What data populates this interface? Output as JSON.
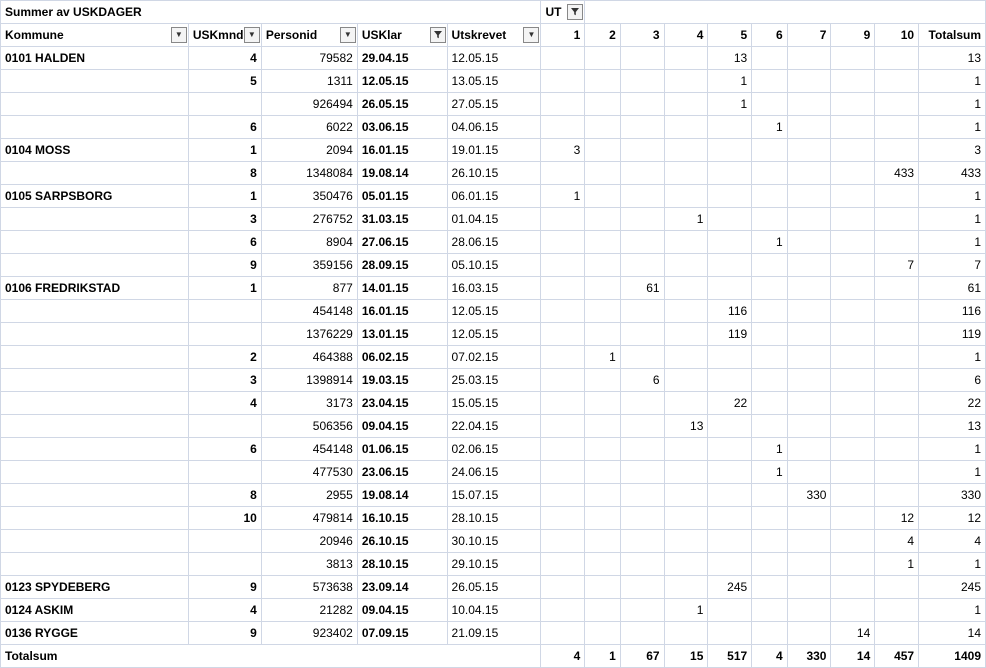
{
  "title": "Summer av USKDAGER",
  "ut_label": "UT",
  "headers": {
    "kommune": "Kommune",
    "uskmnd": "USKmnd",
    "personid": "Personid",
    "usklar": "USKlar",
    "utskrevet": "Utskrevet",
    "c1": "1",
    "c2": "2",
    "c3": "3",
    "c4": "4",
    "c5": "5",
    "c6": "6",
    "c7": "7",
    "c9": "9",
    "c10": "10",
    "totalsum": "Totalsum"
  },
  "rows": [
    {
      "kommune": "0101 HALDEN",
      "mnd": "4",
      "pid": "79582",
      "klar": "29.04.15",
      "ut": "12.05.15",
      "v": {
        "5": "13"
      },
      "tot": "13"
    },
    {
      "kommune": "",
      "mnd": "5",
      "pid": "1311",
      "klar": "12.05.15",
      "ut": "13.05.15",
      "v": {
        "5": "1"
      },
      "tot": "1"
    },
    {
      "kommune": "",
      "mnd": "",
      "pid": "926494",
      "klar": "26.05.15",
      "ut": "27.05.15",
      "v": {
        "5": "1"
      },
      "tot": "1"
    },
    {
      "kommune": "",
      "mnd": "6",
      "pid": "6022",
      "klar": "03.06.15",
      "ut": "04.06.15",
      "v": {
        "6": "1"
      },
      "tot": "1"
    },
    {
      "kommune": "0104 MOSS",
      "mnd": "1",
      "pid": "2094",
      "klar": "16.01.15",
      "ut": "19.01.15",
      "v": {
        "1": "3"
      },
      "tot": "3"
    },
    {
      "kommune": "",
      "mnd": "8",
      "pid": "1348084",
      "klar": "19.08.14",
      "ut": "26.10.15",
      "v": {
        "10": "433"
      },
      "tot": "433"
    },
    {
      "kommune": "0105 SARPSBORG",
      "mnd": "1",
      "pid": "350476",
      "klar": "05.01.15",
      "ut": "06.01.15",
      "v": {
        "1": "1"
      },
      "tot": "1"
    },
    {
      "kommune": "",
      "mnd": "3",
      "pid": "276752",
      "klar": "31.03.15",
      "ut": "01.04.15",
      "v": {
        "4": "1"
      },
      "tot": "1"
    },
    {
      "kommune": "",
      "mnd": "6",
      "pid": "8904",
      "klar": "27.06.15",
      "ut": "28.06.15",
      "v": {
        "6": "1"
      },
      "tot": "1"
    },
    {
      "kommune": "",
      "mnd": "9",
      "pid": "359156",
      "klar": "28.09.15",
      "ut": "05.10.15",
      "v": {
        "10": "7"
      },
      "tot": "7"
    },
    {
      "kommune": "0106 FREDRIKSTAD",
      "mnd": "1",
      "pid": "877",
      "klar": "14.01.15",
      "ut": "16.03.15",
      "v": {
        "3": "61"
      },
      "tot": "61"
    },
    {
      "kommune": "",
      "mnd": "",
      "pid": "454148",
      "klar": "16.01.15",
      "ut": "12.05.15",
      "v": {
        "5": "116"
      },
      "tot": "116"
    },
    {
      "kommune": "",
      "mnd": "",
      "pid": "1376229",
      "klar": "13.01.15",
      "ut": "12.05.15",
      "v": {
        "5": "119"
      },
      "tot": "119"
    },
    {
      "kommune": "",
      "mnd": "2",
      "pid": "464388",
      "klar": "06.02.15",
      "ut": "07.02.15",
      "v": {
        "2": "1"
      },
      "tot": "1"
    },
    {
      "kommune": "",
      "mnd": "3",
      "pid": "1398914",
      "klar": "19.03.15",
      "ut": "25.03.15",
      "v": {
        "3": "6"
      },
      "tot": "6"
    },
    {
      "kommune": "",
      "mnd": "4",
      "pid": "3173",
      "klar": "23.04.15",
      "ut": "15.05.15",
      "v": {
        "5": "22"
      },
      "tot": "22"
    },
    {
      "kommune": "",
      "mnd": "",
      "pid": "506356",
      "klar": "09.04.15",
      "ut": "22.04.15",
      "v": {
        "4": "13"
      },
      "tot": "13"
    },
    {
      "kommune": "",
      "mnd": "6",
      "pid": "454148",
      "klar": "01.06.15",
      "ut": "02.06.15",
      "v": {
        "6": "1"
      },
      "tot": "1"
    },
    {
      "kommune": "",
      "mnd": "",
      "pid": "477530",
      "klar": "23.06.15",
      "ut": "24.06.15",
      "v": {
        "6": "1"
      },
      "tot": "1"
    },
    {
      "kommune": "",
      "mnd": "8",
      "pid": "2955",
      "klar": "19.08.14",
      "ut": "15.07.15",
      "v": {
        "7": "330"
      },
      "tot": "330"
    },
    {
      "kommune": "",
      "mnd": "10",
      "pid": "479814",
      "klar": "16.10.15",
      "ut": "28.10.15",
      "v": {
        "10": "12"
      },
      "tot": "12"
    },
    {
      "kommune": "",
      "mnd": "",
      "pid": "20946",
      "klar": "26.10.15",
      "ut": "30.10.15",
      "v": {
        "10": "4"
      },
      "tot": "4"
    },
    {
      "kommune": "",
      "mnd": "",
      "pid": "3813",
      "klar": "28.10.15",
      "ut": "29.10.15",
      "v": {
        "10": "1"
      },
      "tot": "1"
    },
    {
      "kommune": "0123 SPYDEBERG",
      "mnd": "9",
      "pid": "573638",
      "klar": "23.09.14",
      "ut": "26.05.15",
      "v": {
        "5": "245"
      },
      "tot": "245"
    },
    {
      "kommune": "0124 ASKIM",
      "mnd": "4",
      "pid": "21282",
      "klar": "09.04.15",
      "ut": "10.04.15",
      "v": {
        "4": "1"
      },
      "tot": "1"
    },
    {
      "kommune": "0136 RYGGE",
      "mnd": "9",
      "pid": "923402",
      "klar": "07.09.15",
      "ut": "21.09.15",
      "v": {
        "9": "14"
      },
      "tot": "14"
    }
  ],
  "totals": {
    "label": "Totalsum",
    "c1": "4",
    "c2": "1",
    "c3": "67",
    "c4": "15",
    "c5": "517",
    "c6": "4",
    "c7": "330",
    "c9": "14",
    "c10": "457",
    "total": "1409"
  }
}
